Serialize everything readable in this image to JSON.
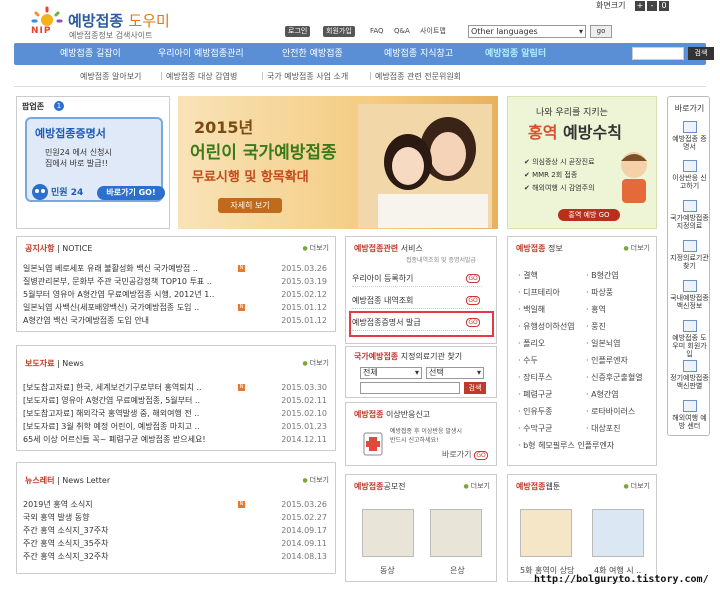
{
  "header": {
    "logo_text": "NIP",
    "title_main": "예방접종",
    "title_accent": "도우미",
    "subtitle": "예방접종정보 검색사이트",
    "btn_login": "로그인",
    "btn_join": "회원가입",
    "link_faq": "FAQ",
    "link_qa": "Q&A",
    "link_sitemap": "사이트맵",
    "lang_select": "Other languages",
    "lang_go": "go",
    "font_size_label": "화면크기",
    "font_btns": [
      "+",
      "-",
      "0"
    ]
  },
  "nav": {
    "items": [
      "예방접종 길잡이",
      "우리아이 예방접종관리",
      "안전한 예방접종",
      "예방접종 지식창고",
      "예방접종 알림터"
    ],
    "search_btn": "검색"
  },
  "subnav": {
    "items": [
      "예방접종 알아보기",
      "예방접종 대상 감염병",
      "국가 예방접종 사업 소개",
      "예방접종 관련 전문위원회"
    ]
  },
  "popup": {
    "title": "팝업존",
    "num": "1",
    "cert_title": "예방접종증명서",
    "desc": "민원24 에서 신청시\n집에서 바로 발급!!",
    "minwon": "민원 24",
    "go_label": "바로가기 GO!"
  },
  "banner": {
    "year": "2015년",
    "line1": "어린이 국가예방접종",
    "line2": "무료시행 및 항목확대",
    "more": "자세히 보기"
  },
  "right_banner": {
    "line1": "나와 우리를 지키는",
    "line2a": "홍역",
    "line2b": "예방수칙",
    "checks": [
      "의심증상 시 곧장진료",
      "MMR 2회 접종",
      "해외여행 시 감염주의"
    ],
    "go": "홍역 예방 GO"
  },
  "quick": {
    "title": "바로가기",
    "items": [
      "예방접종 증명서",
      "이상반응 신고하기",
      "국가예방접종 지정의료",
      "지정의료기관 찾기",
      "국내예방접종 백신정보",
      "예방접종 도우미 회원가입",
      "정기예방접종 백신판별",
      "해외여행 예방 센터"
    ]
  },
  "notice": {
    "title_a": "공지사항",
    "title_b": "NOTICE",
    "more": "더보기",
    "rows": [
      {
        "text": "일본뇌염 베로세포 유래 불활성화 백신 국가예방접 ..",
        "date": "2015.03.26",
        "new": true
      },
      {
        "text": "질병관리본부, 문화부 주관 국민공감정책 TOP10 투표 ..",
        "date": "2015.03.19",
        "new": false
      },
      {
        "text": "5월부터 영유아 A형간염 무료예방접종 시행, 2012년 1..",
        "date": "2015.02.12",
        "new": false
      },
      {
        "text": "일본뇌염 사백신(세포배양백신) 국가예방접종 도입 ..",
        "date": "2015.01.12",
        "new": true
      },
      {
        "text": "A형간염 백신 국가예방접종 도입 안내",
        "date": "2015.01.12",
        "new": false
      }
    ]
  },
  "press": {
    "title_a": "보도자료",
    "title_b": "News",
    "more": "더보기",
    "rows": [
      {
        "text": "[보도참고자료] 한국, 세계보건기구로부터 홍역퇴치 ..",
        "date": "2015.03.30",
        "new": true
      },
      {
        "text": "[보도자료] 영유아 A형간염 무료예방접종, 5월부터 ..",
        "date": "2015.02.11",
        "new": false
      },
      {
        "text": "[보도참고자료] 해외각국 홍역발생 중, 해외여행 전 ..",
        "date": "2015.02.10",
        "new": false
      },
      {
        "text": "[보도자료] 3월 취학 예정 어린이, 예방접종 마치고 ..",
        "date": "2015.01.23",
        "new": false
      },
      {
        "text": "65세 이상 어르신들 꼭~ 폐렴구균 예방접종 받으세요!",
        "date": "2014.12.11",
        "new": false
      }
    ]
  },
  "newsletter": {
    "title_a": "뉴스레터",
    "title_b": "News Letter",
    "more": "더보기",
    "rows": [
      {
        "text": "2019년 홍역 소식지",
        "date": "2015.03.26",
        "new": true
      },
      {
        "text": "국외 홍역 발생 동향",
        "date": "2015.02.27",
        "new": false
      },
      {
        "text": "주간 홍역 소식지_37주차",
        "date": "2014.09.17",
        "new": false
      },
      {
        "text": "주간 홍역 소식지_35주차",
        "date": "2014.09.11",
        "new": false
      },
      {
        "text": "주간 홍역 소식지_32주차",
        "date": "2014.08.13",
        "new": false
      }
    ]
  },
  "service": {
    "title_a": "예방접종관련",
    "title_b": "서비스",
    "subtitle": "접종내역조회 및 증명서발급",
    "items": [
      "우리아이 등록하기",
      "예방접종 내역조회",
      "예방접종증명서 발급"
    ],
    "go": "GO"
  },
  "clinic": {
    "title_a": "국가예방접종",
    "title_b": "지정의료기관 찾기",
    "sel1": "전체",
    "sel2": "선택",
    "btn": "검색"
  },
  "adverse": {
    "title_a": "예방접종",
    "title_b": "이상반응신고",
    "desc": "예방접종 후 이상반응 발생시\n반드시 신고하세요!",
    "link": "바로가기",
    "go": "GO"
  },
  "disease": {
    "title_a": "예방접종",
    "title_b": "정보",
    "more": "더보기",
    "col1": [
      "결핵",
      "디프테리아",
      "백일해",
      "유행성이하선염",
      "폴리오",
      "수두",
      "장티푸스",
      "폐렴구균",
      "인유두종",
      "수막구균",
      "b형 헤모필루스 인플루엔자"
    ],
    "col2": [
      "B형간염",
      "파상풍",
      "홍역",
      "풍진",
      "일본뇌염",
      "인플루엔자",
      "신증후군출혈열",
      "A형간염",
      "로타바이러스",
      "대상포진"
    ]
  },
  "contest": {
    "title_a": "예방접종",
    "title_b": "공모전",
    "more": "더보기",
    "caps": [
      "동상",
      "은상"
    ]
  },
  "webtoon": {
    "title_a": "예방접종",
    "title_b": "웹툰",
    "more": "더보기",
    "caps": [
      "5화 홍역이 상당",
      "4화 여행 시 .."
    ]
  },
  "watermark": "http://bolguryto.tistory.com/"
}
